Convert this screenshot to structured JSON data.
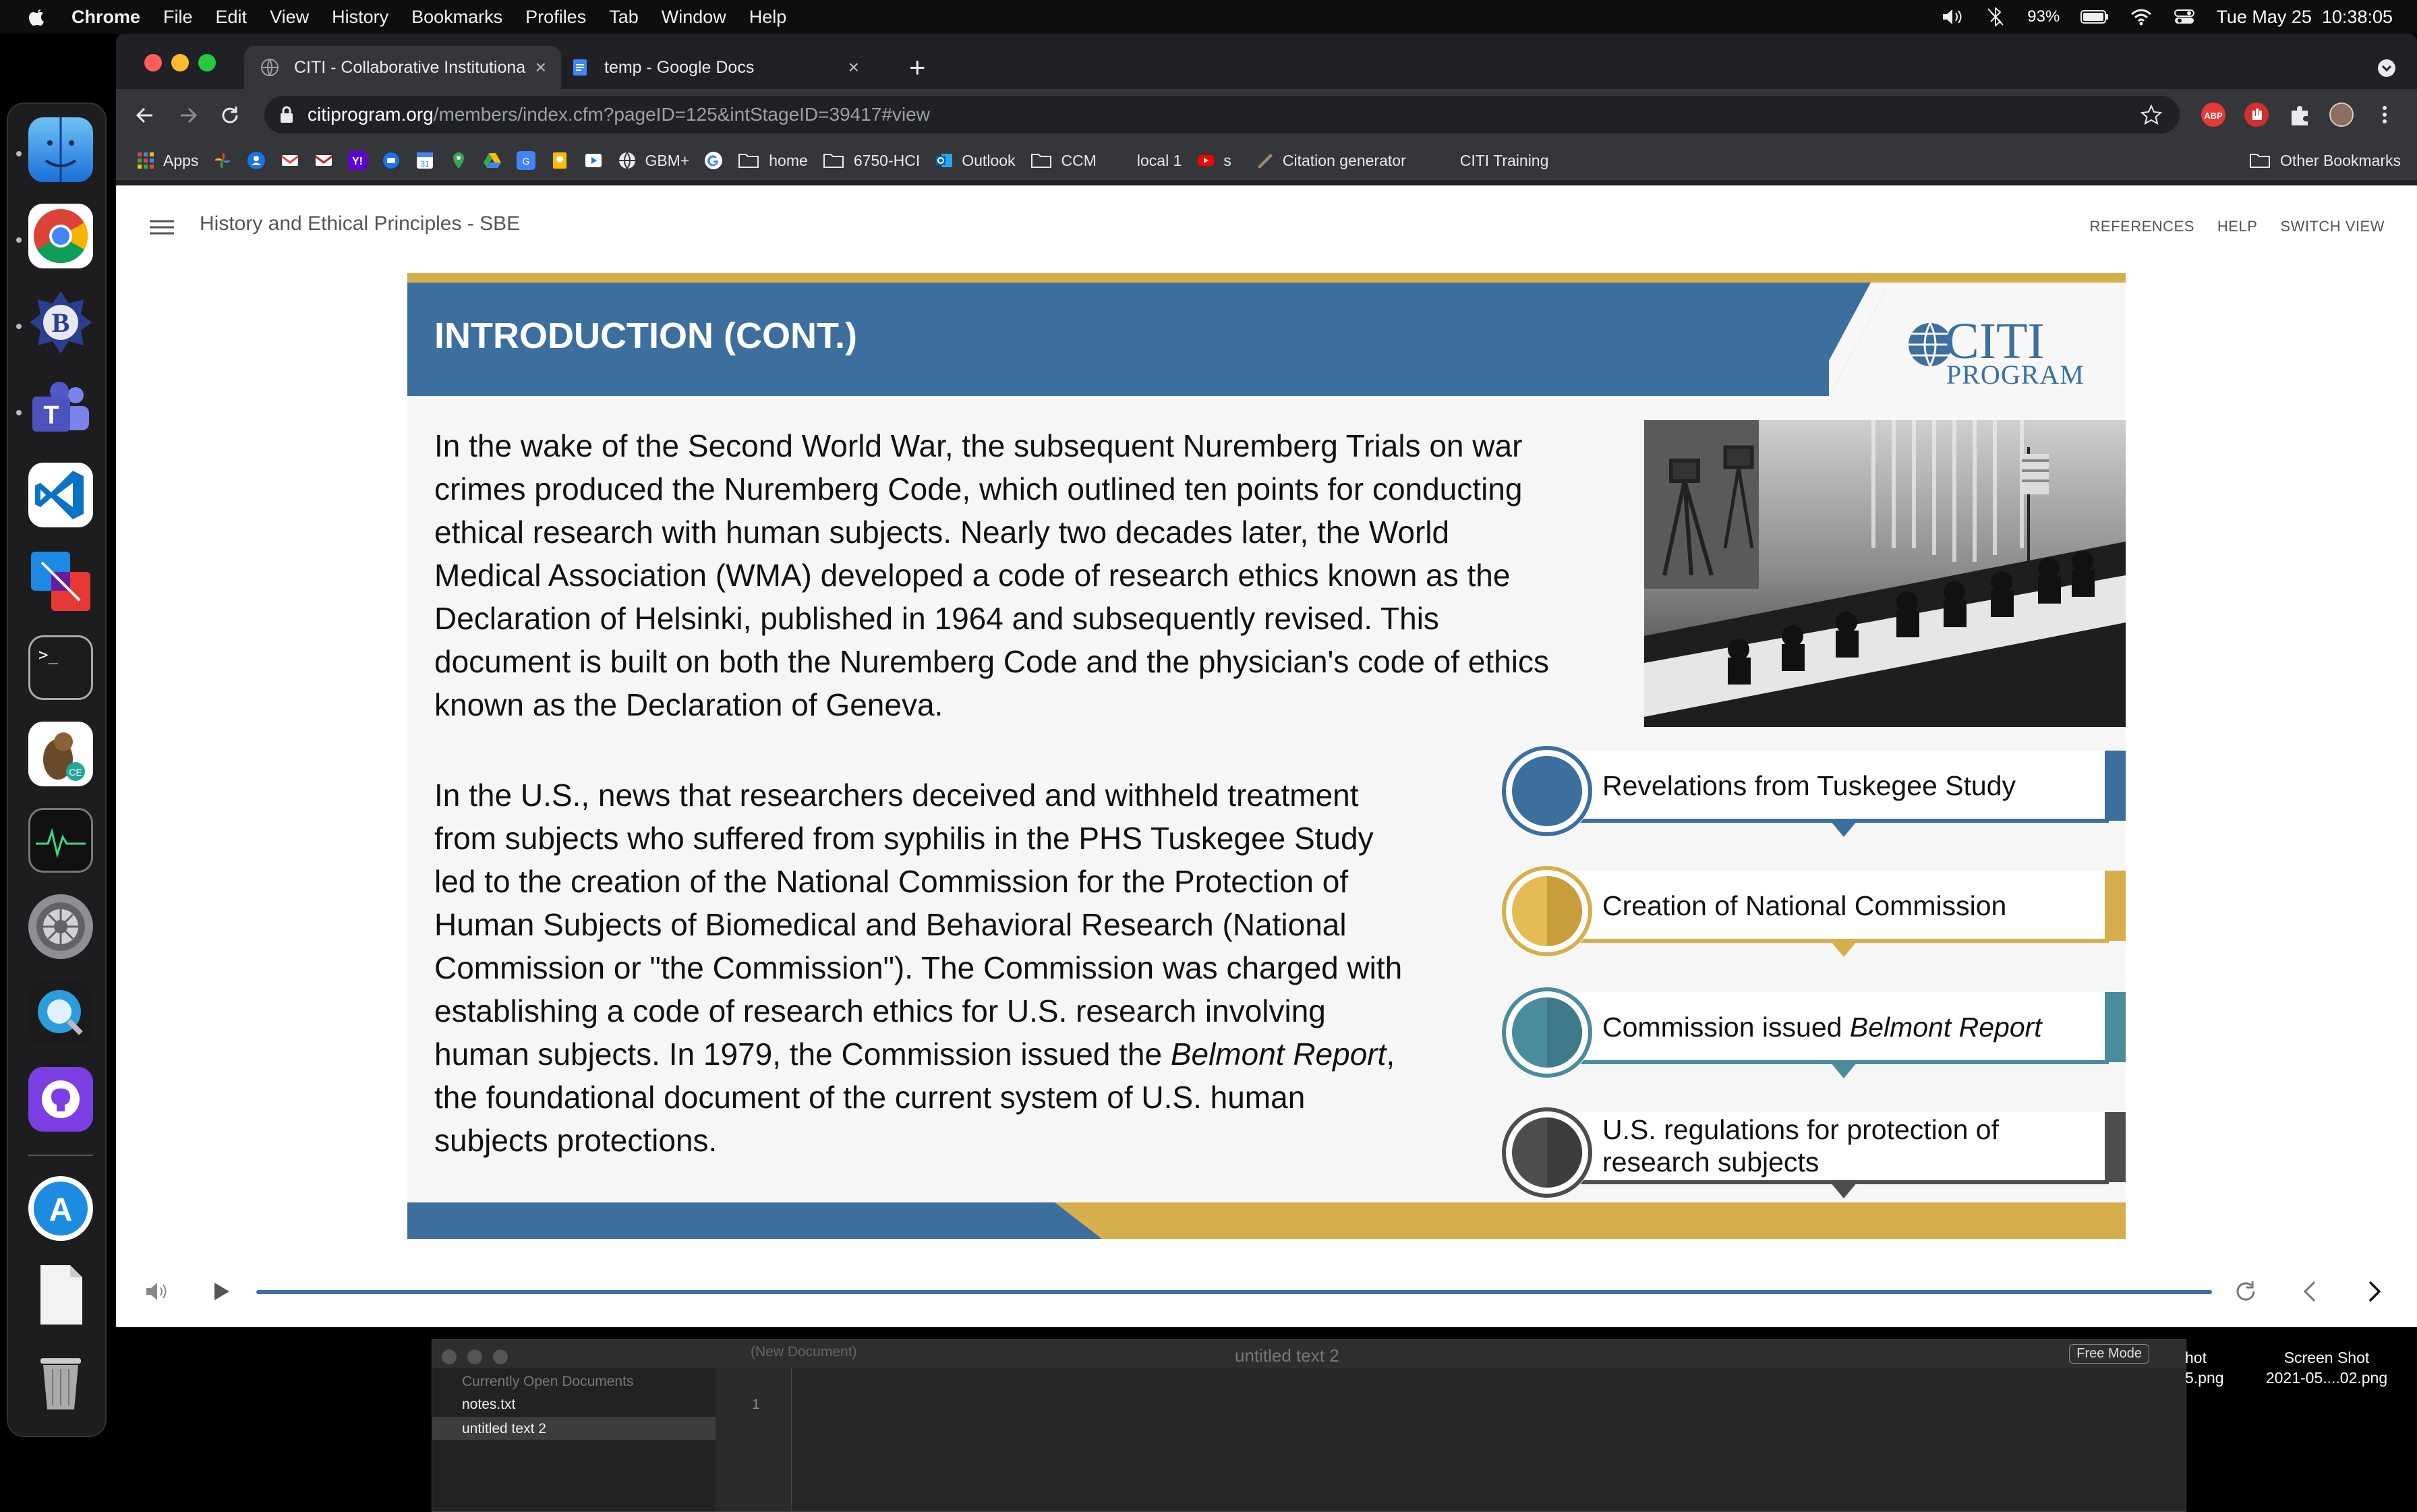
{
  "menubar": {
    "app": "Chrome",
    "menus": [
      "File",
      "Edit",
      "View",
      "History",
      "Bookmarks",
      "Profiles",
      "Tab",
      "Window",
      "Help"
    ],
    "battery": "93%",
    "clock": "Tue May 25  10:38:05"
  },
  "tabs": [
    {
      "title": "CITI - Collaborative Institutiona"
    },
    {
      "title": "temp - Google Docs"
    }
  ],
  "address": {
    "host": "citiprogram.org",
    "path": "/members/index.cfm?pageID=125&intStageID=39417#view"
  },
  "bookmarks": {
    "apps": "Apps",
    "gbm": "GBM+",
    "home": "home",
    "hci": "6750-HCI",
    "outlook": "Outlook",
    "ccm": "CCM",
    "local": "local 1",
    "s": "s",
    "citation": "Citation generator",
    "citi_training": "CITI Training",
    "other": "Other Bookmarks"
  },
  "page": {
    "course_title": "History and Ethical Principles - SBE",
    "links": {
      "references": "REFERENCES",
      "help": "HELP",
      "switch_view": "SWITCH VIEW"
    }
  },
  "slide": {
    "title": "INTRODUCTION (CONT.)",
    "logo_top": "CITI",
    "logo_bottom": "PROGRAM",
    "p1_lines": [
      "In the wake of the Second World War, the subsequent Nuremberg Trials on war",
      "crimes produced the Nuremberg Code, which outlined ten points for conducting",
      "ethical research with human subjects. Nearly two decades later, the World",
      "Medical Association (WMA) developed a code of research ethics known as the",
      "Declaration of Helsinki, published in 1964 and subsequently revised. This",
      "document is built on both the Nuremberg Code and the physician's code of ethics",
      "known as the Declaration of Geneva."
    ],
    "p2_lines": [
      "In the U.S., news that researchers deceived and withheld treatment",
      "from subjects who suffered from syphilis in the PHS Tuskegee Study",
      "led to the creation of the National Commission for the Protection of",
      "Human Subjects of Biomedical and Behavioral Research (National",
      "Commission or \"the Commission\"). The Commission was charged with",
      "establishing a code of research ethics for U.S. research involving"
    ],
    "p2_line7_pre": "human subjects. In 1979, the Commission issued the ",
    "p2_line7_em": "Belmont Report",
    "p2_line7_post": ",",
    "p2_lines_end": [
      "the foundational document of the current system of U.S. human",
      "subjects protections."
    ],
    "timeline": [
      {
        "label": "Revelations from Tuskegee Study",
        "color": "#3c6f9e"
      },
      {
        "label": "Creation of National Commission",
        "color": "#d6ae4c"
      },
      {
        "label_pre": "Commission issued ",
        "label_em": "Belmont Report",
        "color": "#4a8c9b"
      },
      {
        "label_line1": "U.S. regulations for protection of",
        "label_line2": "research subjects",
        "color": "#4d4d4d"
      }
    ],
    "colors": {
      "blue": "#3c6f9e",
      "gold": "#d6ae4c",
      "teal": "#4a8c9b",
      "dark": "#4d4d4d"
    }
  },
  "editor": {
    "title": "untitled text 2",
    "free_mode": "Free Mode",
    "sidebar_header": "Currently Open Documents",
    "doc_selector": "(New Document)",
    "files": [
      "notes.txt",
      "untitled text 2"
    ],
    "line_number": "1"
  },
  "desktop": {
    "file1_line1": "hot",
    "file1_line2": "5.png",
    "file2_line1": "Screen Shot",
    "file2_line2": "2021-05....02.png"
  }
}
